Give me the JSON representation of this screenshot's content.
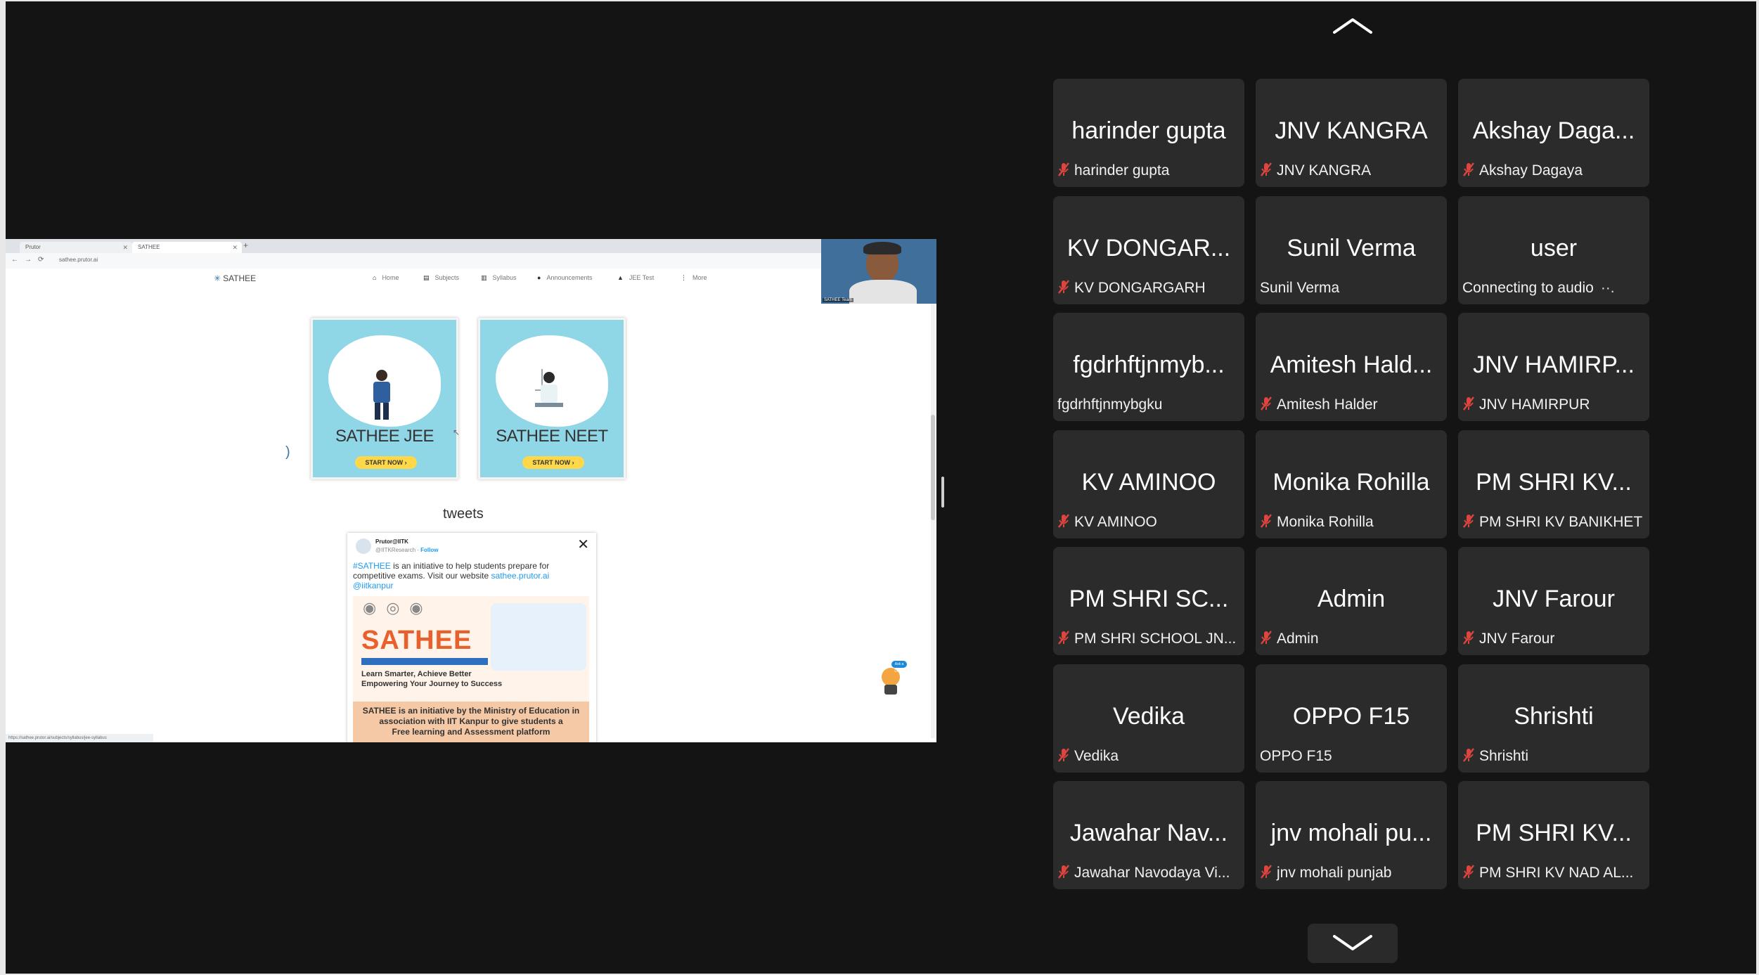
{
  "browser": {
    "tabs": [
      {
        "label": "Prutor"
      },
      {
        "label": "SATHEE"
      }
    ],
    "new_tab_glyph": "+",
    "url": "sathee.prutor.ai",
    "status_url": "https://sathee.prutor.ai/subjects/syllabus/jee-syllabus"
  },
  "site": {
    "logo": "SATHEE",
    "nav": [
      {
        "label": "Home",
        "icon": "home-icon"
      },
      {
        "label": "Subjects",
        "icon": "book-icon"
      },
      {
        "label": "Syllabus",
        "icon": "syllabus-icon"
      },
      {
        "label": "Announcements",
        "icon": "person-icon"
      },
      {
        "label": "JEE Test",
        "icon": "graduation-cap-icon"
      },
      {
        "label": "More",
        "icon": "more-vertical-icon"
      }
    ],
    "cards": [
      {
        "title": "SATHEE JEE",
        "button": "START NOW"
      },
      {
        "title": "SATHEE NEET",
        "button": "START NOW"
      }
    ],
    "tweets_heading": "tweets",
    "tweet": {
      "account": "Prutor@IITK",
      "handle": "@IITKResearch",
      "follow": "Follow",
      "text_hashtag": "#SATHEE",
      "text_body": " is an initiative to help students prepare for competitive exams. Visit our website ",
      "text_link": "sathee.prutor.ai",
      "text_mention": "@iitkanpur",
      "poster_brand": "SATHEE",
      "poster_tagline_1": "Learn Smarter, Achieve Better",
      "poster_tagline_2": "Empowering Your Journey to Success",
      "poster_footer_1": "SATHEE is an initiative by the Ministry of Education in",
      "poster_footer_2": "association with IIT Kanpur to give students a",
      "poster_footer_3": "Free learning and Assessment platform"
    },
    "bot_bubble": "Ask a Doubt",
    "presenter_label": "SATHEE Team"
  },
  "participants": [
    {
      "display": "harinder gupta",
      "name": "harinder gupta",
      "muted": true
    },
    {
      "display": "JNV KANGRA",
      "name": "JNV KANGRA",
      "muted": true
    },
    {
      "display": "Akshay Daga...",
      "name": "Akshay Dagaya",
      "muted": true
    },
    {
      "display": "KV DONGAR...",
      "name": "KV DONGARGARH",
      "muted": true
    },
    {
      "display": "Sunil Verma",
      "name": "Sunil Verma",
      "muted": false
    },
    {
      "display": "user",
      "name": "Connecting to audio",
      "muted": false,
      "connecting": true
    },
    {
      "display": "fgdrhftjnmyb...",
      "name": "fgdrhftjnmybgku",
      "muted": false
    },
    {
      "display": "Amitesh Hald...",
      "name": "Amitesh Halder",
      "muted": true
    },
    {
      "display": "JNV HAMIRP...",
      "name": "JNV HAMIRPUR",
      "muted": true
    },
    {
      "display": "KV AMINOO",
      "name": "KV AMINOO",
      "muted": true
    },
    {
      "display": "Monika Rohilla",
      "name": "Monika Rohilla",
      "muted": true
    },
    {
      "display": "PM SHRI KV...",
      "name": "PM SHRI KV BANIKHET",
      "muted": true
    },
    {
      "display": "PM SHRI SC...",
      "name": "PM SHRI SCHOOL JN...",
      "muted": true
    },
    {
      "display": "Admin",
      "name": "Admin",
      "muted": true
    },
    {
      "display": "JNV Farour",
      "name": "JNV Farour",
      "muted": true
    },
    {
      "display": "Vedika",
      "name": "Vedika",
      "muted": true
    },
    {
      "display": "OPPO F15",
      "name": "OPPO F15",
      "muted": false
    },
    {
      "display": "Shrishti",
      "name": "Shrishti",
      "muted": true
    },
    {
      "display": "Jawahar Nav...",
      "name": "Jawahar Navodaya Vi...",
      "muted": true
    },
    {
      "display": "jnv mohali pu...",
      "name": "jnv mohali punjab",
      "muted": true
    },
    {
      "display": "PM SHRI KV...",
      "name": "PM SHRI KV NAD AL...",
      "muted": true
    }
  ],
  "colors": {
    "stage": "#141414",
    "tile": "#2b2b2b",
    "muted_icon": "#e0443e",
    "card": "#8fd6e6",
    "brand_orange": "#e8602c"
  },
  "icons": {
    "scroll_up": "chevron-up-icon",
    "scroll_down": "chevron-down-icon",
    "muted": "mic-off-icon",
    "connecting": "more-horizontal-icon"
  }
}
